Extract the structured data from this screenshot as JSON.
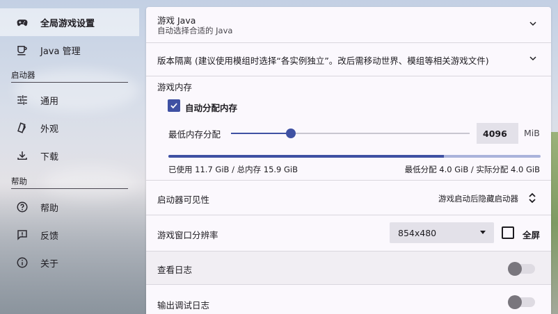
{
  "sidebar": {
    "items_top": [
      {
        "label": "全局游戏设置",
        "icon": "gamepad-icon",
        "active": true
      },
      {
        "label": "Java 管理",
        "icon": "java-cup-icon",
        "active": false
      }
    ],
    "section_launcher": "启动器",
    "items_launcher": [
      {
        "label": "通用",
        "icon": "tune-icon"
      },
      {
        "label": "外观",
        "icon": "brush-icon"
      },
      {
        "label": "下载",
        "icon": "download-icon"
      }
    ],
    "section_help": "帮助",
    "items_help": [
      {
        "label": "帮助",
        "icon": "help-circle-icon"
      },
      {
        "label": "反馈",
        "icon": "feedback-icon"
      },
      {
        "label": "关于",
        "icon": "info-icon"
      }
    ]
  },
  "main": {
    "java": {
      "title": "游戏 Java",
      "subtitle": "自动选择合适的 Java"
    },
    "isolation": {
      "title": "版本隔离 (建议使用模组时选择“各实例独立”。改后需移动世界、模组等相关游戏文件)"
    },
    "memory": {
      "title": "游戏内存",
      "auto_label": "自动分配内存",
      "auto_checked": true,
      "min_label": "最低内存分配",
      "min_value": "4096",
      "unit": "MiB",
      "slider_fraction": 0.25,
      "used_fraction": 0.74,
      "used_text": "已使用 11.7 GiB / 总内存 15.9 GiB",
      "alloc_text": "最低分配 4.0 GiB / 实际分配 4.0 GiB"
    },
    "visibility": {
      "title": "启动器可见性",
      "value": "游戏启动后隐藏启动器"
    },
    "resolution": {
      "title": "游戏窗口分辨率",
      "value": "854x480",
      "fullscreen_label": "全屏",
      "fullscreen_checked": false
    },
    "logs": {
      "title": "查看日志",
      "on": false
    },
    "debug_logs": {
      "title": "输出调试日志",
      "on": false
    }
  },
  "colors": {
    "accent": "#3f51a3",
    "panel": "#fbf8fd"
  }
}
